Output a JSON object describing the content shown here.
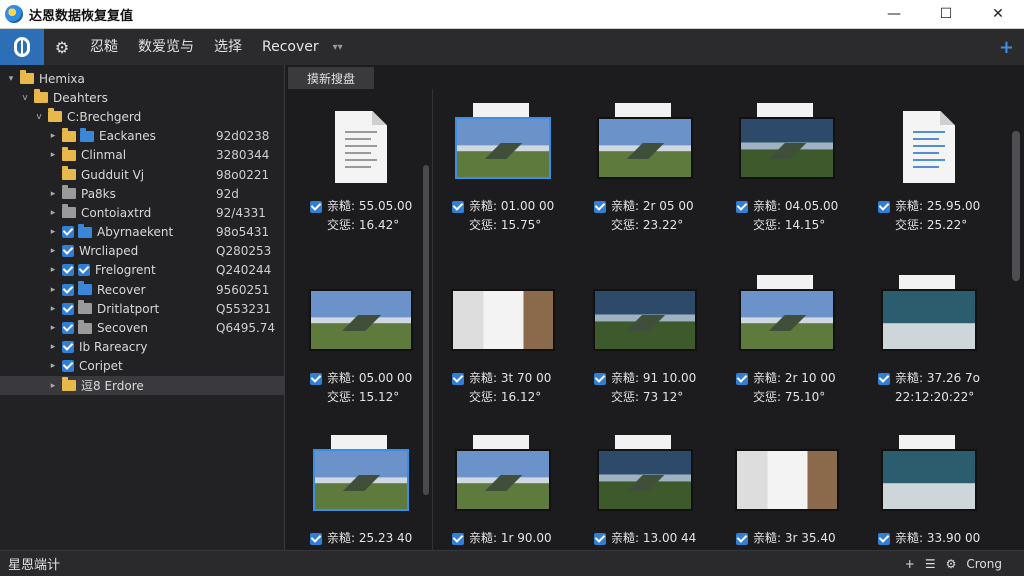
{
  "window": {
    "title": "达恩数据恢复复值",
    "controls": {
      "minimize": "—",
      "maximize": "☐",
      "close": "✕"
    }
  },
  "toolbar": {
    "menu": [
      "忍糙",
      "数爱览与",
      "选择",
      "Recover"
    ],
    "more": "▾▾",
    "add": "+"
  },
  "tree": {
    "rows": [
      {
        "label": "Hemixa",
        "arrow": "▾",
        "check": false,
        "folder": "yellow",
        "size": "",
        "indent": 0
      },
      {
        "label": "Deahters",
        "arrow": "v",
        "check": false,
        "folder": "yellow",
        "size": "",
        "indent": 1
      },
      {
        "label": "C:Brechgerd",
        "arrow": "v",
        "check": false,
        "folder": "yellow",
        "size": "",
        "indent": 2
      },
      {
        "label": "Eackanes",
        "arrow": "▸",
        "check": false,
        "folder": "yellow",
        "folder2": "blue",
        "size": "92d0238",
        "indent": 3
      },
      {
        "label": "Clinmal",
        "arrow": "▸",
        "check": false,
        "folder": "yellow",
        "size": "3280344",
        "indent": 3
      },
      {
        "label": "Gudduit Vj",
        "arrow": "",
        "check": false,
        "folder": "yellow",
        "size": "98o0221",
        "indent": 3
      },
      {
        "label": "Pa8ks",
        "arrow": "▸",
        "check": false,
        "folder": "gray",
        "size": "92d",
        "indent": 3
      },
      {
        "label": "Contoiaxtrd",
        "arrow": "▸",
        "check": false,
        "folder": "gray",
        "size": "92/4331",
        "indent": 3
      },
      {
        "label": "Abyrnaekent",
        "arrow": "▸",
        "check": true,
        "folder": "blue",
        "size": "98o5431",
        "indent": 3
      },
      {
        "label": "Wrcliaped",
        "arrow": "▸",
        "check": true,
        "folder": "",
        "size": "Q280253",
        "indent": 3
      },
      {
        "label": "Frelogrent",
        "arrow": "▸",
        "check": true,
        "check2": true,
        "folder": "",
        "size": "Q240244",
        "indent": 3
      },
      {
        "label": "Recover",
        "arrow": "▸",
        "check": true,
        "folder": "blue",
        "size": "9560251",
        "indent": 3
      },
      {
        "label": "Dritlatport",
        "arrow": "▸",
        "check": true,
        "folder": "gray",
        "size": "Q553231",
        "indent": 3
      },
      {
        "label": "Secoven",
        "arrow": "▸",
        "check": true,
        "folder": "gray",
        "size": "Q6495.74",
        "indent": 3
      },
      {
        "label": "Ib Rareacry",
        "arrow": "▸",
        "check": true,
        "folder": "",
        "size": "",
        "indent": 3
      },
      {
        "label": "Coripet",
        "arrow": "▸",
        "check": true,
        "folder": "",
        "size": "",
        "indent": 3
      },
      {
        "label": "逗8 Erdore",
        "arrow": "▸",
        "check": false,
        "folder": "yellow",
        "size": "",
        "indent": 3,
        "selected": true
      }
    ]
  },
  "content": {
    "tab": "摸新搜盘",
    "tiles": [
      {
        "kind": "doc",
        "date": "亲糙: 55.05.00",
        "time": "交惩: 16.42°"
      },
      {
        "kind": "photo-stack",
        "style": "mtn",
        "selected": true,
        "date": "亲糙: 01.00 00",
        "time": "交惩: 15.75°"
      },
      {
        "kind": "photo-stack",
        "style": "mtn",
        "date": "亲糙: 2r 05 00",
        "time": "交惩: 23.22°"
      },
      {
        "kind": "photo-stack",
        "style": "dark",
        "date": "亲糙: 04.05.00",
        "time": "交惩: 14.15°"
      },
      {
        "kind": "doc-blue",
        "date": "亲糙: 25.95.00",
        "time": "交惩: 25.22°"
      },
      {
        "kind": "photo",
        "style": "mtn",
        "date": "亲糙: 05.00 00",
        "time": "交惩: 15.12°"
      },
      {
        "kind": "photo",
        "style": "room",
        "date": "亲糙: 3t 70 00",
        "time": "交惩: 16.12°"
      },
      {
        "kind": "photo",
        "style": "dark",
        "date": "亲糙: 91 10.00",
        "time": "交惩: 73 12°"
      },
      {
        "kind": "photo-stack",
        "style": "mtn",
        "date": "亲糙: 2r 10 00",
        "time": "交惩: 75.10°"
      },
      {
        "kind": "photo-stack",
        "style": "teal",
        "date": "亲糙: 37.26 7o",
        "time": "22:12:20:22°"
      },
      {
        "kind": "doc-photo",
        "style": "mtn",
        "selected": true,
        "date": "亲糙: 25.23 40",
        "time": ""
      },
      {
        "kind": "photo-stack",
        "style": "mtn",
        "date": "亲糙: 1r 90.00",
        "time": ""
      },
      {
        "kind": "photo-stack",
        "style": "dark",
        "date": "亲糙: 13.00 44",
        "time": ""
      },
      {
        "kind": "photo",
        "style": "room",
        "date": "亲糙: 3r 35.40",
        "time": ""
      },
      {
        "kind": "photo-stack",
        "style": "teal",
        "date": "亲糙: 33.90 00",
        "time": ""
      }
    ]
  },
  "status": {
    "left": "星恩端计",
    "right_plus": "+",
    "right_label": "Crong"
  }
}
